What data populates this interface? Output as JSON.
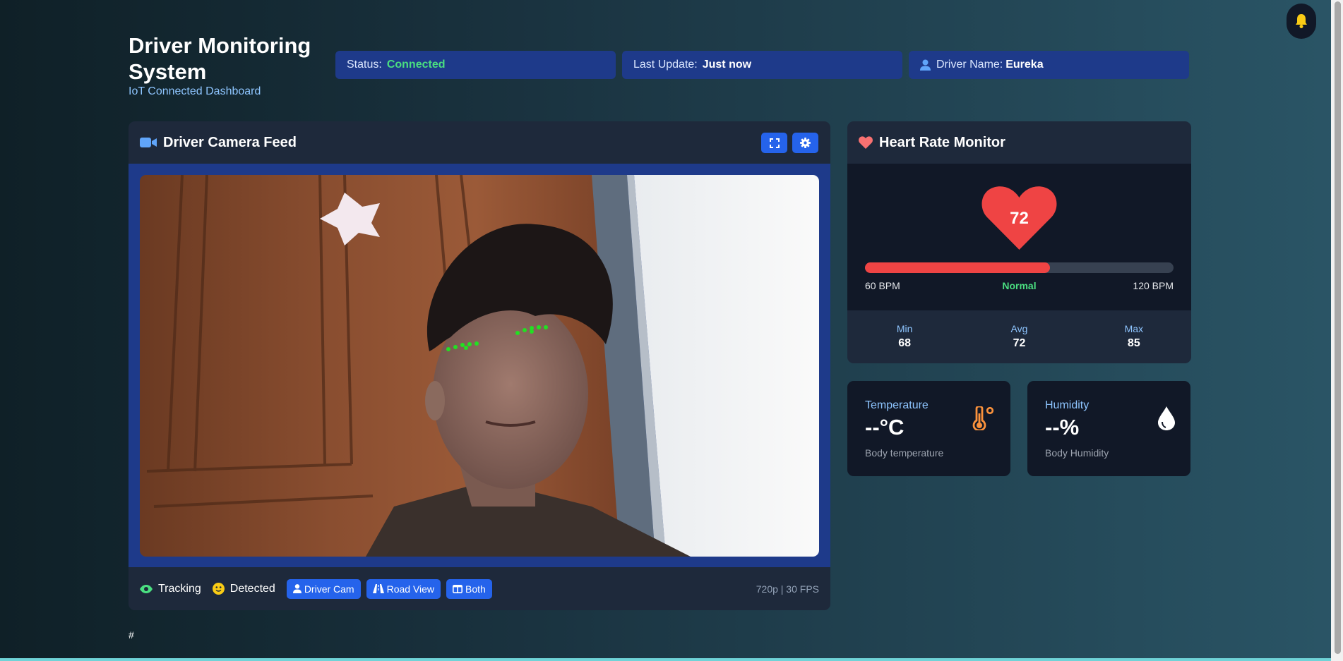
{
  "header": {
    "title": "Driver Monitoring System",
    "subtitle": "IoT Connected Dashboard",
    "status_label": "Status:",
    "status_value": "Connected",
    "update_label": "Last Update:",
    "update_value": "Just now",
    "driver_label": "Driver Name:",
    "driver_value": "Eureka"
  },
  "camera": {
    "title": "Driver Camera Feed",
    "tracking_label": "Tracking",
    "detected_label": "Detected",
    "buttons": [
      "Driver Cam",
      "Road View",
      "Both"
    ],
    "resolution": "720p | 30 FPS"
  },
  "heart_rate": {
    "title": "Heart Rate Monitor",
    "value": "72",
    "min_label": "60 BPM",
    "max_label": "120 BPM",
    "status": "Normal",
    "level": 0.6,
    "stats": [
      {
        "label": "Min",
        "value": "68"
      },
      {
        "label": "Avg",
        "value": "72"
      },
      {
        "label": "Max",
        "value": "85"
      }
    ]
  },
  "temperature": {
    "label": "Temperature",
    "value": "--°C",
    "description": "Body temperature"
  },
  "humidity": {
    "label": "Humidity",
    "value": "--%",
    "description": "Body Humidity"
  },
  "footer_text": "#",
  "icons": {
    "notification": "bell-icon",
    "camera": "video-camera-icon",
    "expand": "expand-icon",
    "settings": "gear-icon",
    "heart": "heart-icon",
    "tracking": "eye-icon",
    "detected": "smile-icon",
    "temperature": "thermometer-icon",
    "humidity": "droplet-icon"
  },
  "colors": {
    "accent": "#2563eb",
    "status_connected": "#4ade80",
    "heart": "#ef4444",
    "pill_bg": "#1e3a8a",
    "card_bg": "#1e293b"
  }
}
